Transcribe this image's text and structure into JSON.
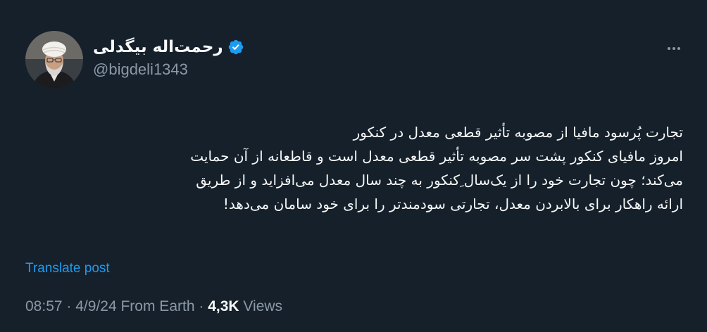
{
  "author": {
    "display_name": "رحمت‌اله بیگدلی",
    "handle": "@bigdeli1343",
    "verified": true,
    "avatar_icon": "profile-photo-cleric",
    "verified_icon": "verified-badge-icon",
    "verified_color": "#1d9bf0"
  },
  "post": {
    "lines": [
      "تجارت پُرسود مافیا از مصوبه تأثیر قطعی معدل در کنکور",
      "امروز مافیای کنکور پشت سر مصوبه تأثیر قطعی معدل است و قاطعانه از آن حمایت",
      "می‌کند؛ چون تجارت خود را از یک‌سال ِکنکور به چند سال معدل می‌افزاید و از طریق",
      "ارائه راهکار برای بالابردن معدل، تجارتی سودمندتر را برای خود سامان می‌دهد!"
    ],
    "translate_label": "Translate post",
    "time": "08:57",
    "date": "4/9/24",
    "source": "From Earth",
    "separator": "·",
    "views_count": "4,3K",
    "views_label": "Views"
  },
  "menu": {
    "more_icon": "more-horizontal-icon"
  },
  "colors": {
    "background": "#15202b",
    "primary_text": "#f7f9f9",
    "secondary_text": "#8b98a5",
    "accent": "#1d9bf0"
  }
}
